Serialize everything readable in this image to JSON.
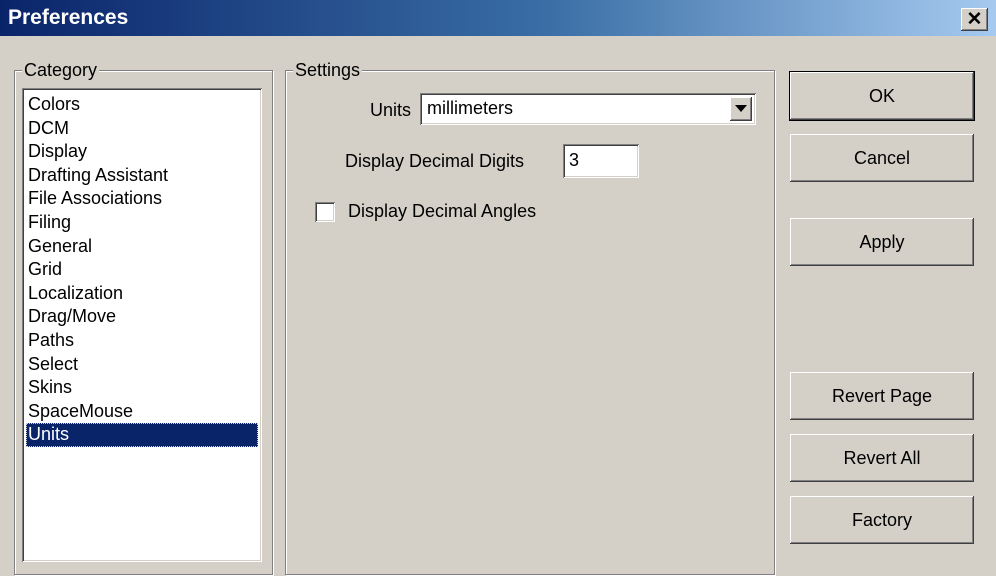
{
  "window": {
    "title": "Preferences",
    "close_glyph": "✕"
  },
  "category": {
    "legend": "Category",
    "items": [
      "Colors",
      "DCM",
      "Display",
      "Drafting Assistant",
      "File Associations",
      "Filing",
      "General",
      "Grid",
      "Localization",
      "Drag/Move",
      "Paths",
      "Select",
      "Skins",
      "SpaceMouse",
      "Units"
    ],
    "selected": "Units"
  },
  "settings": {
    "legend": "Settings",
    "units_label": "Units",
    "units_value": "millimeters",
    "digits_label": "Display Decimal Digits",
    "digits_value": "3",
    "angles_label": "Display Decimal Angles",
    "angles_checked": false
  },
  "buttons": {
    "ok": "OK",
    "cancel": "Cancel",
    "apply": "Apply",
    "revert_page": "Revert Page",
    "revert_all": "Revert All",
    "factory": "Factory"
  },
  "icons": {
    "close": "close-icon",
    "dropdown": "dropdown-arrow-icon"
  },
  "colors": {
    "title_gradient_start": "#0a246a",
    "title_gradient_end": "#a6caf0",
    "selection": "#0a246a",
    "face": "#d4d0c8"
  }
}
